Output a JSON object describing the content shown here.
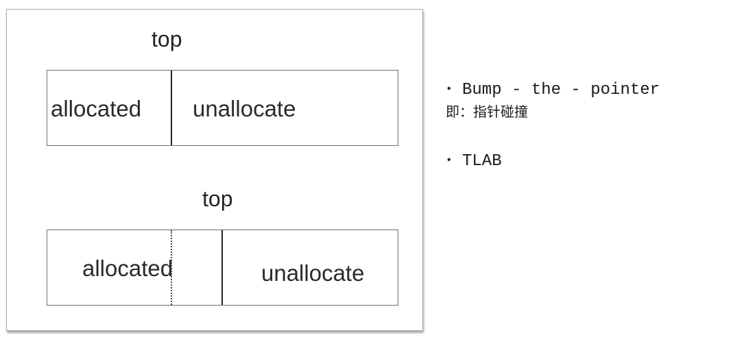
{
  "diagram": {
    "top_label_1": "top",
    "top_label_2": "top",
    "box1": {
      "left_label": "allocated",
      "right_label": "unallocate"
    },
    "box2": {
      "left_label": "allocated",
      "right_label": "unallocate"
    }
  },
  "notes": {
    "items": [
      {
        "text": "Bump - the - pointer",
        "sub": "即：指针碰撞"
      },
      {
        "text": "TLAB"
      }
    ],
    "bullet_symbol": "•"
  }
}
